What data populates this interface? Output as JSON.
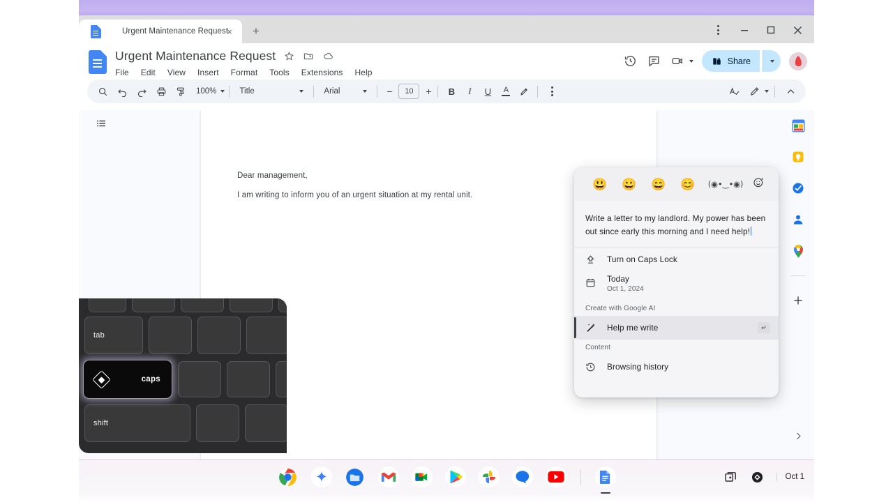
{
  "browser": {
    "tab": {
      "title": "Urgent Maintenance Request",
      "close_label": "×",
      "favicon": "google-docs-favicon"
    },
    "new_tab_label": "+",
    "window_controls": {
      "menu": "⋮",
      "minimize": "—",
      "maximize": "□",
      "close": "✕"
    }
  },
  "docs": {
    "title": "Urgent Maintenance Request",
    "menus": [
      "File",
      "Edit",
      "View",
      "Insert",
      "Format",
      "Tools",
      "Extensions",
      "Help"
    ],
    "title_icons": [
      "star-icon",
      "move-to-folder-icon",
      "cloud-saved-icon"
    ],
    "right_actions": [
      "version-history-icon",
      "comment-icon",
      "meet-camera-icon"
    ],
    "share": {
      "label": "Share",
      "icon": "share-lock-icon",
      "caret": "▾"
    },
    "avatar": "user-avatar"
  },
  "toolbar": {
    "icons": [
      "search-icon",
      "undo-icon",
      "redo-icon",
      "print-icon",
      "paint-format-icon"
    ],
    "zoom": "100%",
    "style": "Title",
    "font": "Arial",
    "font_size": "10",
    "minus": "−",
    "plus": "+",
    "bold": "B",
    "italic": "I",
    "underline": "U",
    "text_color": "A",
    "highlight": "highlighter-icon",
    "more": "⋮",
    "right_icons": [
      "spelling-check-icon",
      "editing-mode-pen-icon",
      "collapse-toolbar-icon"
    ]
  },
  "document": {
    "outline_icon": "document-outline-icon",
    "line1": "Dear management,",
    "line2": "I am writing to inform you of an urgent situation at my rental unit."
  },
  "side_panel": {
    "items": [
      "google-calendar-icon",
      "google-keep-icon",
      "google-tasks-icon",
      "google-contacts-icon",
      "google-maps-icon"
    ],
    "add_label": "+",
    "expand_label": "›"
  },
  "popup": {
    "emojis": [
      "😃",
      "😀",
      "😄",
      "😊"
    ],
    "kaomoji": "(◉•‿•◉)",
    "picker_icon": "emoji-picker-icon",
    "compose_text": "Write a letter to my landlord. My power has been out since early this morning and I need help!",
    "rows": [
      {
        "icon": "caps-lock-icon",
        "label": "Turn on Caps Lock"
      },
      {
        "icon": "calendar-icon",
        "label": "Today",
        "sublabel": "Oct 1, 2024"
      }
    ],
    "section_ai": "Create with Google AI",
    "help_me_write": {
      "icon": "magic-wand-icon",
      "label": "Help me write",
      "key_hint": "↵"
    },
    "section_content": "Content",
    "browsing_history": {
      "icon": "history-icon",
      "label": "Browsing history"
    }
  },
  "keyboard": {
    "keys": [
      {
        "name": "tab",
        "label": "tab"
      },
      {
        "name": "caps",
        "label": "caps",
        "icon": "launcher-diamond-icon",
        "highlighted": true
      },
      {
        "name": "shift",
        "label": "shift"
      }
    ]
  },
  "shelf": {
    "apps": [
      "chrome-icon",
      "gemini-icon",
      "files-icon",
      "gmail-icon",
      "google-meet-icon",
      "google-play-icon",
      "google-photos-icon",
      "google-messages-icon",
      "youtube-icon",
      "google-docs-icon"
    ],
    "status": {
      "desks_icon": "desks-overview-icon",
      "launcher_icon": "launcher-icon",
      "date": "Oct 1"
    }
  },
  "colors": {
    "accent_blue": "#4285f4",
    "share_bg": "#c2e7ff",
    "wallpaper_top": "#c3b2f0",
    "wallpaper_bottom": "#e3c8dd",
    "caps_glow": "#d4c6f0"
  }
}
